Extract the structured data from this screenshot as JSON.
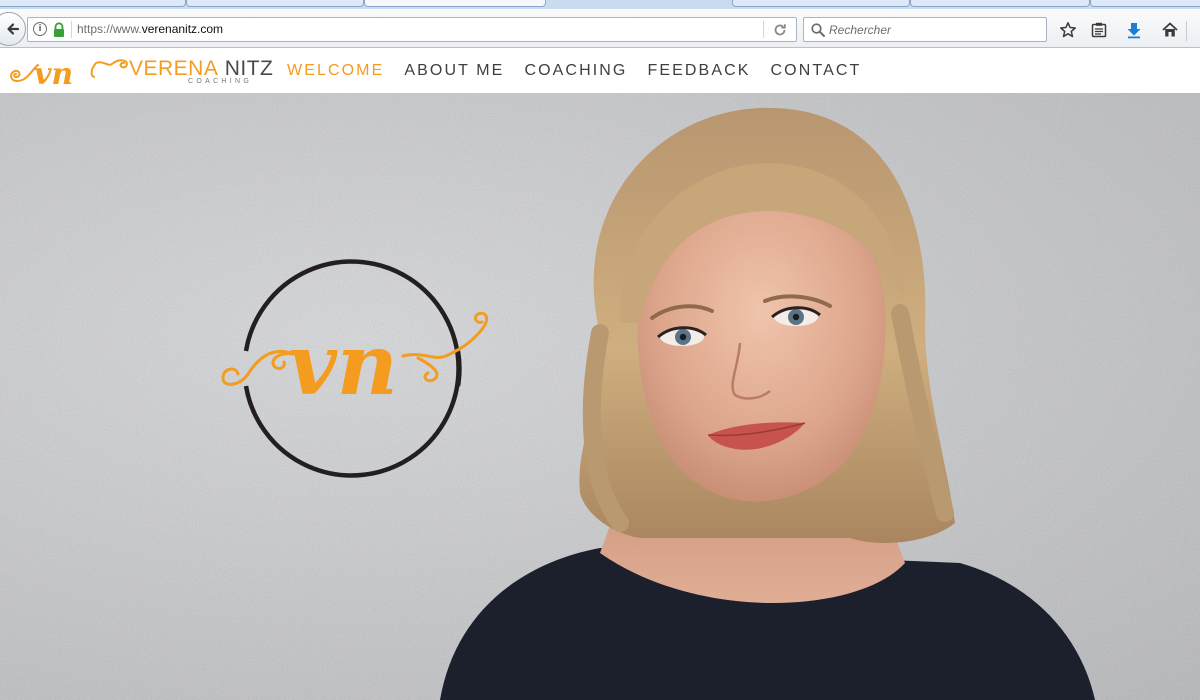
{
  "browser": {
    "url_scheme": "https://www.",
    "url_host": "verenanitz.com",
    "search_placeholder": "Rechercher"
  },
  "site": {
    "brand_first": "VERENA",
    "brand_last": "NITZ",
    "brand_sub": "COACHING",
    "logo_monogram": "vn",
    "nav": [
      {
        "label": "WELCOME",
        "active": true
      },
      {
        "label": "ABOUT ME",
        "active": false
      },
      {
        "label": "COACHING",
        "active": false
      },
      {
        "label": "FEEDBACK",
        "active": false
      },
      {
        "label": "CONTACT",
        "active": false
      }
    ]
  },
  "colors": {
    "accent": "#f39c1f",
    "text": "#3f3f3f",
    "circle": "#231f20"
  },
  "icons": {
    "back": "back-arrow-icon",
    "info": "info-icon",
    "lock": "lock-icon",
    "reload": "reload-icon",
    "search": "search-icon",
    "bookmark": "star-icon",
    "reading_list": "clipboard-icon",
    "downloads": "download-arrow-icon",
    "home": "home-icon"
  }
}
